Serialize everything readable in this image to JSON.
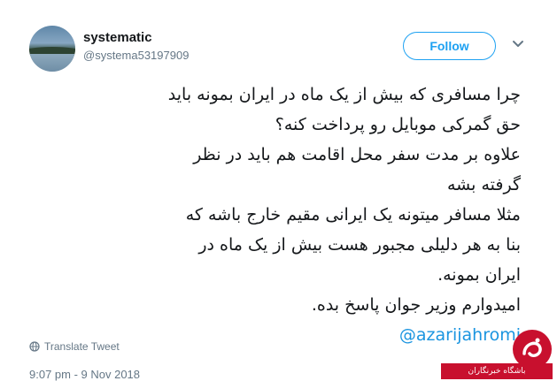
{
  "user": {
    "name": "systematic",
    "handle": "@systema53197909"
  },
  "follow_label": "Follow",
  "tweet": {
    "lines": [
      "چرا مسافری که بیش از یک ماه در ایران بمونه باید",
      "حق گمرکی موبایل رو پرداخت کنه؟",
      "علاوه بر مدت سفر محل اقامت هم باید در نظر",
      "گرفته بشه",
      "مثلا مسافر میتونه یک ایرانی مقیم خارج باشه که",
      "بنا به هر دلیلی مجبور هست بیش از یک ماه در",
      "ایران بمونه.",
      "امیدوارم وزیر جوان پاسخ بده."
    ],
    "mention": "@azarijahromi"
  },
  "translate_label": "Translate Tweet",
  "timestamp": "9:07 pm - 9 Nov 2018",
  "watermark": {
    "label": "باشگاه خبرنگاران",
    "color": "#c8102e"
  },
  "icons": {
    "more": "chevron-down-icon",
    "translate": "globe-icon"
  },
  "colors": {
    "accent": "#1da1f2",
    "text": "#14171a",
    "muted": "#657786"
  }
}
